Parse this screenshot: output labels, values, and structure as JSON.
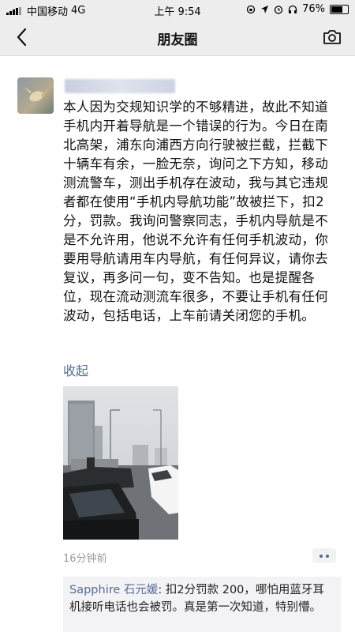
{
  "status_bar": {
    "carrier": "中国移动",
    "network": "4G",
    "time": "上午 9:54",
    "battery_text": "76%",
    "battery_level": 0.76
  },
  "nav": {
    "title": "朋友圈",
    "back_icon": "chevron-left-icon",
    "camera_icon": "camera-icon"
  },
  "post": {
    "author_display": "blurred",
    "content": "本人因为交规知识学的不够精进，故此不知道手机内开着导航是一个错误的行为。今日在南北高架，浦东向浦西方向行驶被拦截，拦截下十辆车有余，一脸无奈，询问之下方知，移动测流警车，测出手机存在波动，我与其它违规者都在使用“手机内导航功能”故被拦下，扣2分，罚款。我询问警察同志，手机内导航是不是不允许用，他说不允许有任何手机波动，你要用导航请用车内导航，有任何异议，请你去复议，再多问一句，变不告知。也是提醒各位，现在流动测流车很多，不要让手机有任何波动，包括电话，上车前请关闭您的手机。",
    "collapse_label": "收起",
    "timestamp": "16分钟前",
    "comment": {
      "author": "Sapphire 石元媛",
      "text": ": 扣2分罚款 200，哪怕用蓝牙耳机接听电话也会被罚。真是第一次知道，特别懵。"
    }
  },
  "colors": {
    "link": "#576b95",
    "bar_bg": "#ededed",
    "comment_bg": "#f3f3f5"
  }
}
